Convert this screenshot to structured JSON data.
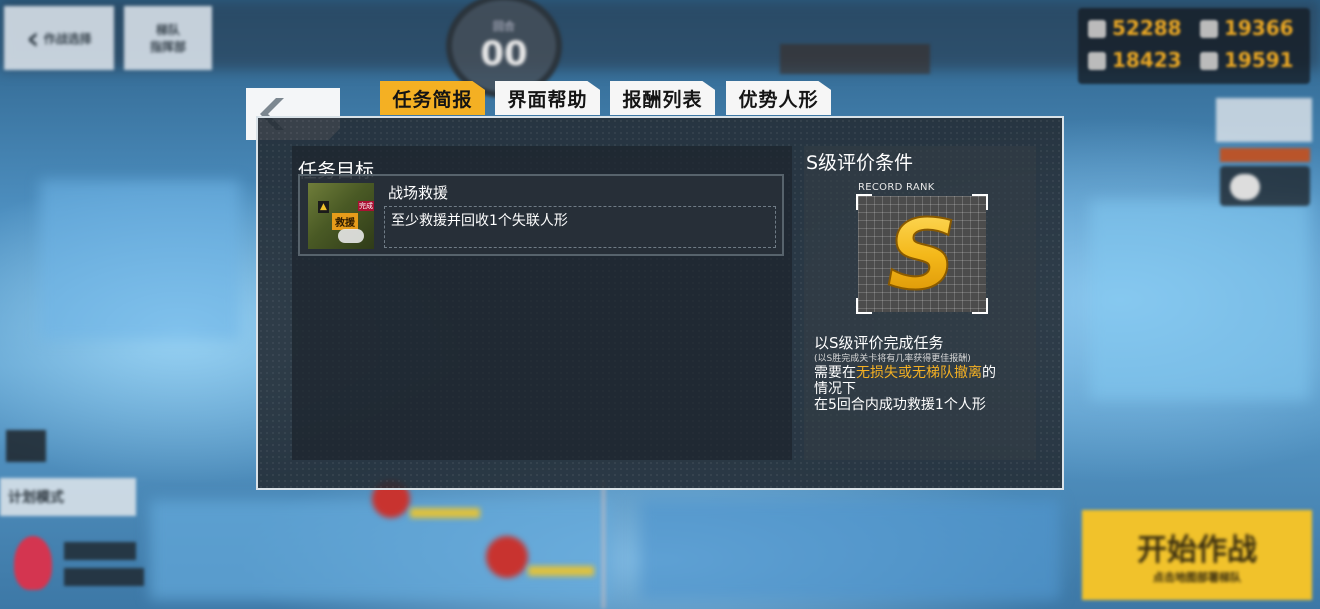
{
  "hud": {
    "top_left_1": "返回",
    "top_left_1_sub": "作战选择",
    "top_left_2": "梯队",
    "top_left_2_sub": "指挥部",
    "turn_label": "回合",
    "turn_value": "00",
    "resources": [
      "52288",
      "19366",
      "18423",
      "19591"
    ],
    "mode_label": "计划模式",
    "start_button": "开始作战",
    "start_sub": "点击地图部署梯队"
  },
  "tabs": [
    {
      "label": "任务简报",
      "active": true
    },
    {
      "label": "界面帮助",
      "active": false
    },
    {
      "label": "报酬列表",
      "active": false
    },
    {
      "label": "优势人形",
      "active": false
    }
  ],
  "objective": {
    "section_title": "任务目标",
    "name": "战场救援",
    "description": "至少救援并回收1个失联人形",
    "thumb_badge": "救援",
    "thumb_tag": "完成"
  },
  "s_rank": {
    "section_title": "S级评价条件",
    "record_label": "RECORD RANK",
    "rank_letter": "S",
    "condition_title": "以S级评价完成任务",
    "condition_note": "(以S胜完成关卡将有几率获得更佳报酬)",
    "line1_pre": "需要在",
    "line1_hl": "无损失或无梯队撤离",
    "line1_post": "的",
    "line2": "情况下",
    "line3": "在5回合内成功救援1个人形"
  },
  "colors": {
    "accent": "#f4b023",
    "panel_bg": "#252e36",
    "rank_gold": "#f1c22b"
  }
}
